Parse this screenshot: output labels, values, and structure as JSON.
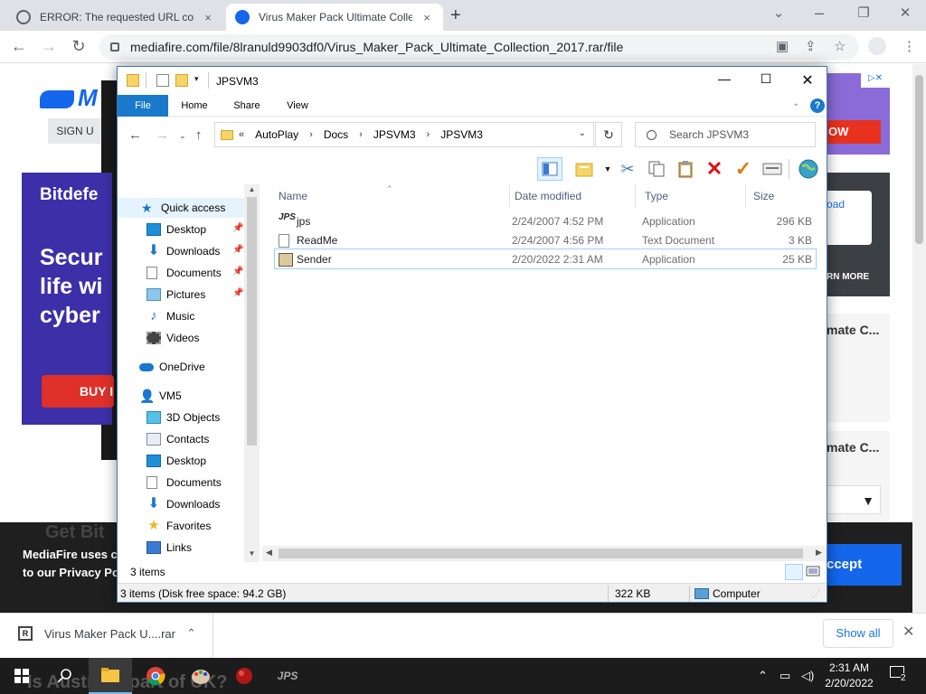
{
  "browser": {
    "tabs": [
      {
        "title": "ERROR: The requested URL could not be retrieved",
        "close": "×"
      },
      {
        "title": "Virus Maker Pack Ultimate Collection",
        "close": "×"
      }
    ],
    "new_tab": "+",
    "window_controls": {
      "minimize": "⌄",
      "restore": "❐",
      "close": "✕"
    },
    "url": "mediafire.com/file/8lranuld9903df0/Virus_Maker_Pack_Ultimate_Collection_2017.rar/file"
  },
  "page": {
    "logo": "M",
    "signup": "SIGN U",
    "ad_left": {
      "brand": "Bitdefe",
      "headline": "Secur\nlife wi\ncyber",
      "buy": "BUY I"
    },
    "ad_right": {
      "cta": "OW"
    },
    "side_card": {
      "link": "oad",
      "more": "RN MORE"
    },
    "mate_1": "mate C...",
    "mate_2": "mate C...",
    "cookie": {
      "text_1": "MediaFire uses c",
      "text_2": "to our Privacy Poli",
      "accept": "ccept"
    }
  },
  "download_shelf": {
    "file_name": "Virus Maker Pack U....rar",
    "show_all": "Show all"
  },
  "taskbar": {
    "time": "2:31 AM",
    "date": "2/20/2022",
    "notifications": "2"
  },
  "explorer": {
    "title": "JPSVM3",
    "ribbon_tabs": [
      "File",
      "Home",
      "Share",
      "View"
    ],
    "breadcrumb": [
      "AutoPlay",
      "Docs",
      "JPSVM3",
      "JPSVM3"
    ],
    "breadcrumb_prefix": "«",
    "search_placeholder": "Search JPSVM3",
    "nav": {
      "quick_access": "Quick access",
      "quick_items": [
        "Desktop",
        "Downloads",
        "Documents",
        "Pictures",
        "Music",
        "Videos"
      ],
      "onedrive": "OneDrive",
      "pc": "VM5",
      "pc_items": [
        "3D Objects",
        "Contacts",
        "Desktop",
        "Documents",
        "Downloads",
        "Favorites",
        "Links"
      ]
    },
    "columns": [
      "Name",
      "Date modified",
      "Type",
      "Size"
    ],
    "files": [
      {
        "name": "jps",
        "date": "2/24/2007 4:52 PM",
        "type": "Application",
        "size": "296 KB"
      },
      {
        "name": "ReadMe",
        "date": "2/24/2007 4:56 PM",
        "type": "Text Document",
        "size": "3 KB"
      },
      {
        "name": "Sender",
        "date": "2/20/2022 2:31 AM",
        "type": "Application",
        "size": "25 KB"
      }
    ],
    "items_count": "3 items",
    "status": {
      "left": "3 items (Disk free space: 94.2 GB)",
      "size": "322 KB",
      "location": "Computer"
    }
  }
}
